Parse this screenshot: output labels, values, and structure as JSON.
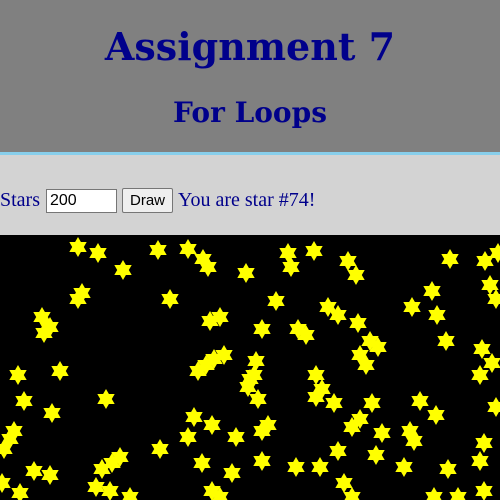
{
  "header": {
    "title": "Assignment 7",
    "subtitle": "For Loops"
  },
  "controls": {
    "stars_label": "Stars",
    "stars_value": "200",
    "draw_label": "Draw",
    "status_text": "You are star #74!"
  },
  "canvas": {
    "background_color": "#000000",
    "star_color": "#ffff00",
    "star_shape": "six-pointed-star"
  },
  "colors": {
    "header_bg": "#808080",
    "header_border": "#87ceeb",
    "title_text": "#00008b",
    "controls_bg": "#d3d3d3"
  }
}
